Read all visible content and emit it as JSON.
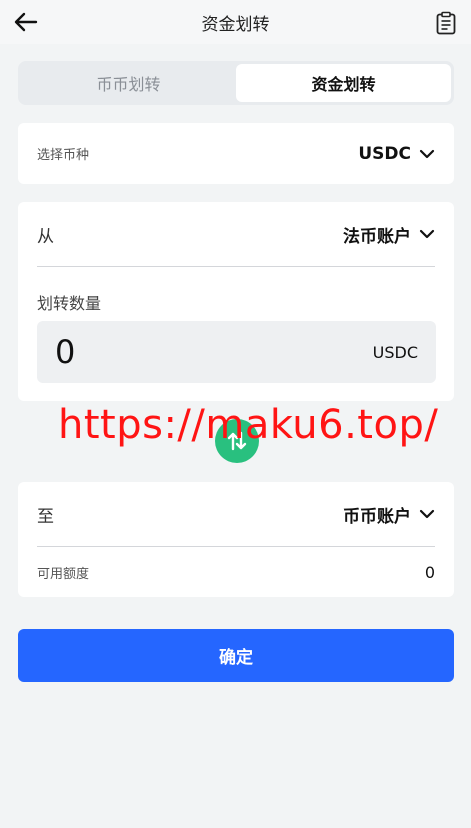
{
  "header": {
    "title": "资金划转",
    "back_icon": "arrow-left-icon",
    "record_icon": "clipboard-list-icon"
  },
  "tabs": [
    {
      "label": "币币划转",
      "active": false
    },
    {
      "label": "资金划转",
      "active": true
    }
  ],
  "coin": {
    "label": "选择币种",
    "value": "USDC"
  },
  "from": {
    "label": "从",
    "account": "法币账户",
    "amount_label": "划转数量",
    "amount_value": "0",
    "amount_unit": "USDC"
  },
  "watermark": "https://maku6.top/",
  "to": {
    "label": "至",
    "account": "币币账户",
    "available_label": "可用额度",
    "available_value": "0"
  },
  "confirm": {
    "label": "确定"
  },
  "colors": {
    "accent": "#2566ff",
    "swap": "#29c07f",
    "background": "#f2f4f5",
    "watermark": "#ff1414"
  }
}
